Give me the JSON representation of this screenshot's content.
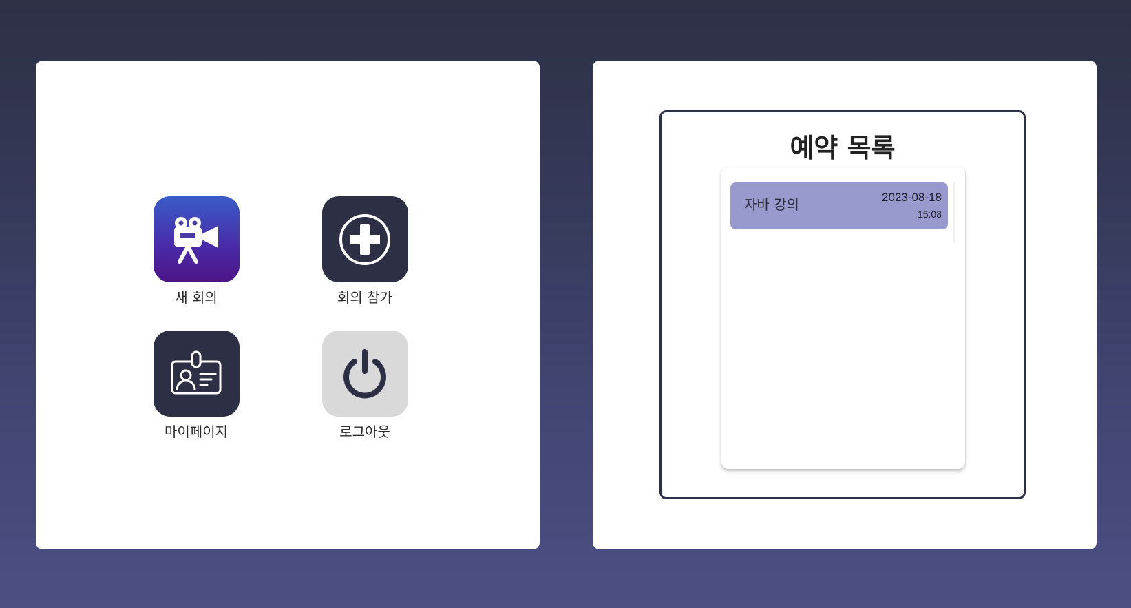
{
  "menu": {
    "new_meeting": {
      "label": "새 회의",
      "icon": "video-camera-icon"
    },
    "join_meeting": {
      "label": "회의 참가",
      "icon": "plus-circle-icon"
    },
    "my_page": {
      "label": "마이페이지",
      "icon": "id-card-icon"
    },
    "logout": {
      "label": "로그아웃",
      "icon": "power-icon"
    }
  },
  "reservations": {
    "title": "예약 목록",
    "items": [
      {
        "title": "자바 강의",
        "date": "2023-08-18",
        "time": "15:08"
      }
    ]
  },
  "colors": {
    "background_top": "#2e3046",
    "background_bottom": "#4b4f82",
    "tile_dark": "#2d2f45",
    "tile_gray": "#d9d9d9",
    "reservation_item": "#9899cc"
  }
}
